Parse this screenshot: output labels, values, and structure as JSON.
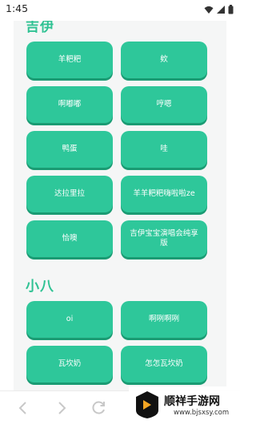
{
  "status_bar": {
    "time": "1:45"
  },
  "sections": [
    {
      "title": "吉伊",
      "buttons": [
        "羊粑粑",
        "欸",
        "啊嘟嘟",
        "哼嗯",
        "鸭蛋",
        "哇",
        "达拉里拉",
        "羊羊粑粑嗨啦啦ze",
        "恰噢",
        "吉伊宝宝演唱会纯享版"
      ]
    },
    {
      "title": "小八",
      "buttons": [
        "oi",
        "啊咧啊咧",
        "瓦坎奶",
        "怎怎瓦坎奶"
      ]
    }
  ],
  "watermark": {
    "title": "顺祥手游网",
    "url": "www.bjsxsy.com"
  },
  "colors": {
    "accent": "#2fc293",
    "tile": "#2ec79a",
    "tile_shadow": "#1a9b73"
  }
}
